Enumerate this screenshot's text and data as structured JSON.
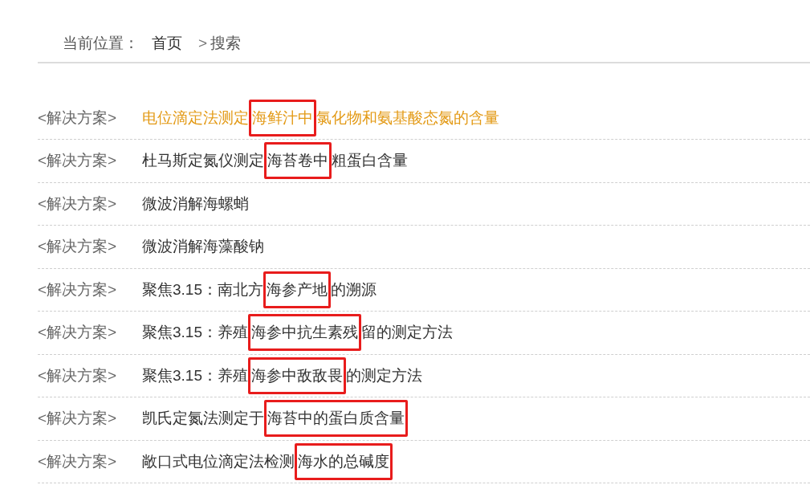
{
  "breadcrumb": {
    "label": "当前位置：",
    "items": [
      {
        "text": "首页",
        "kind": "link"
      },
      {
        "text": ">",
        "kind": "separator"
      },
      {
        "text": "搜索",
        "kind": "current"
      }
    ]
  },
  "results": [
    {
      "tag": "<解决方案>",
      "title": {
        "before": "电位滴定法测定",
        "marked": "海鲜汁中",
        "after": "氯化物和氨基酸态氮的含量"
      },
      "selected": true
    },
    {
      "tag": "<解决方案>",
      "title": {
        "before": "杜马斯定氮仪测定",
        "marked": "海苔卷中",
        "after": "粗蛋白含量"
      },
      "selected": false
    },
    {
      "tag": "<解决方案>",
      "title": {
        "before": "微波消解海螺蛸"
      },
      "selected": false
    },
    {
      "tag": "<解决方案>",
      "title": {
        "before": "微波消解海藻酸钠"
      },
      "selected": false
    },
    {
      "tag": "<解决方案>",
      "title": {
        "before": "聚焦3.15：南北方",
        "marked": "海参产地",
        "after": "的溯源"
      },
      "selected": false
    },
    {
      "tag": "<解决方案>",
      "title": {
        "before": "聚焦3.15：养殖",
        "marked": "海参中抗生素残",
        "after": "留的测定方法"
      },
      "selected": false
    },
    {
      "tag": "<解决方案>",
      "title": {
        "before": "聚焦3.15：养殖",
        "marked": "海参中敌敌畏",
        "after": "的测定方法"
      },
      "selected": false
    },
    {
      "tag": "<解决方案>",
      "title": {
        "before": "凯氏定氮法测定于",
        "marked": "海苔中的蛋白质含量"
      },
      "selected": false
    },
    {
      "tag": "<解决方案>",
      "title": {
        "before": "敞口式电位滴定法检测",
        "marked": "海水的总碱度"
      },
      "selected": false
    }
  ]
}
